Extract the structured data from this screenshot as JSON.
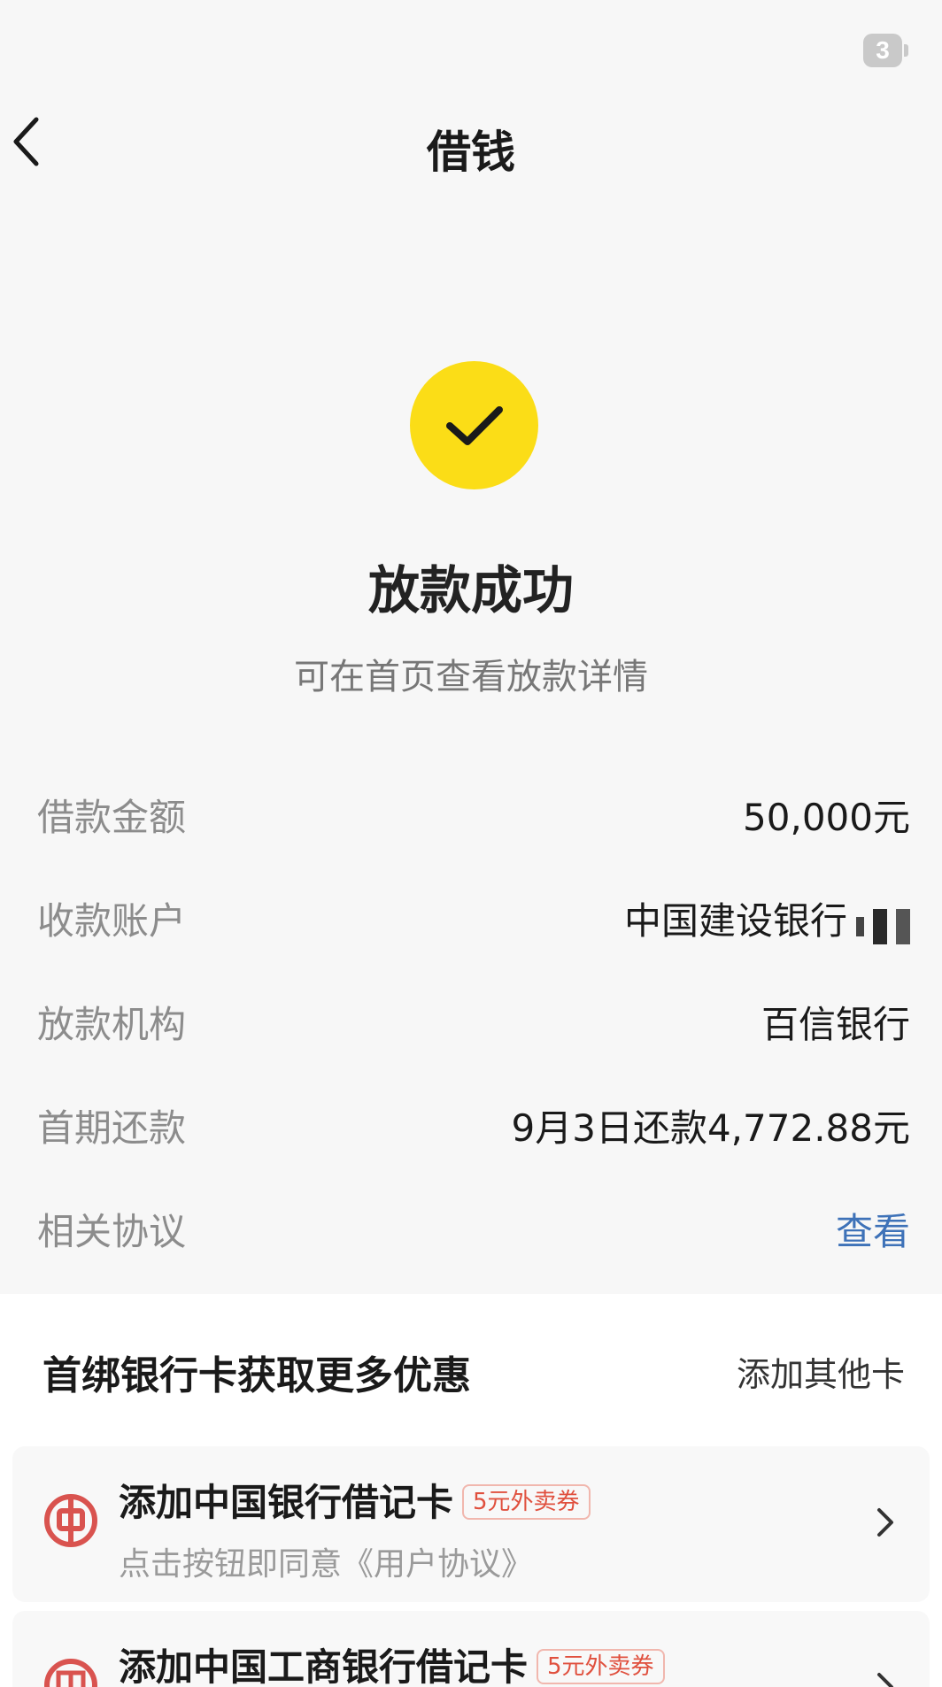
{
  "status_bar": {
    "battery_level": "3"
  },
  "nav": {
    "title": "借钱"
  },
  "result": {
    "title": "放款成功",
    "subtitle": "可在首页查看放款详情",
    "icon_color": "#fbdd17"
  },
  "details": [
    {
      "label": "借款金额",
      "value": "50,000元"
    },
    {
      "label": "收款账户",
      "value": "中国建设银行"
    },
    {
      "label": "放款机构",
      "value": "百信银行"
    },
    {
      "label": "首期还款",
      "value": "9月3日还款4,772.88元"
    },
    {
      "label": "相关协议",
      "value": "查看"
    }
  ],
  "cards": {
    "title": "首绑银行卡获取更多优惠",
    "add_other": "添加其他卡",
    "items": [
      {
        "name": "添加中国银行借记卡",
        "coupon": "5元外卖券",
        "desc": "点击按钮即同意《用户协议》",
        "logo_icon": "bank-of-china-icon",
        "logo_color": "#d9534f"
      },
      {
        "name": "添加中国工商银行借记卡",
        "coupon": "5元外卖券",
        "logo_icon": "icbc-icon",
        "logo_color": "#d9534f"
      }
    ]
  },
  "colors": {
    "link": "#3e72b8",
    "accent": "#fbdd17",
    "coupon": "#e0503e"
  }
}
